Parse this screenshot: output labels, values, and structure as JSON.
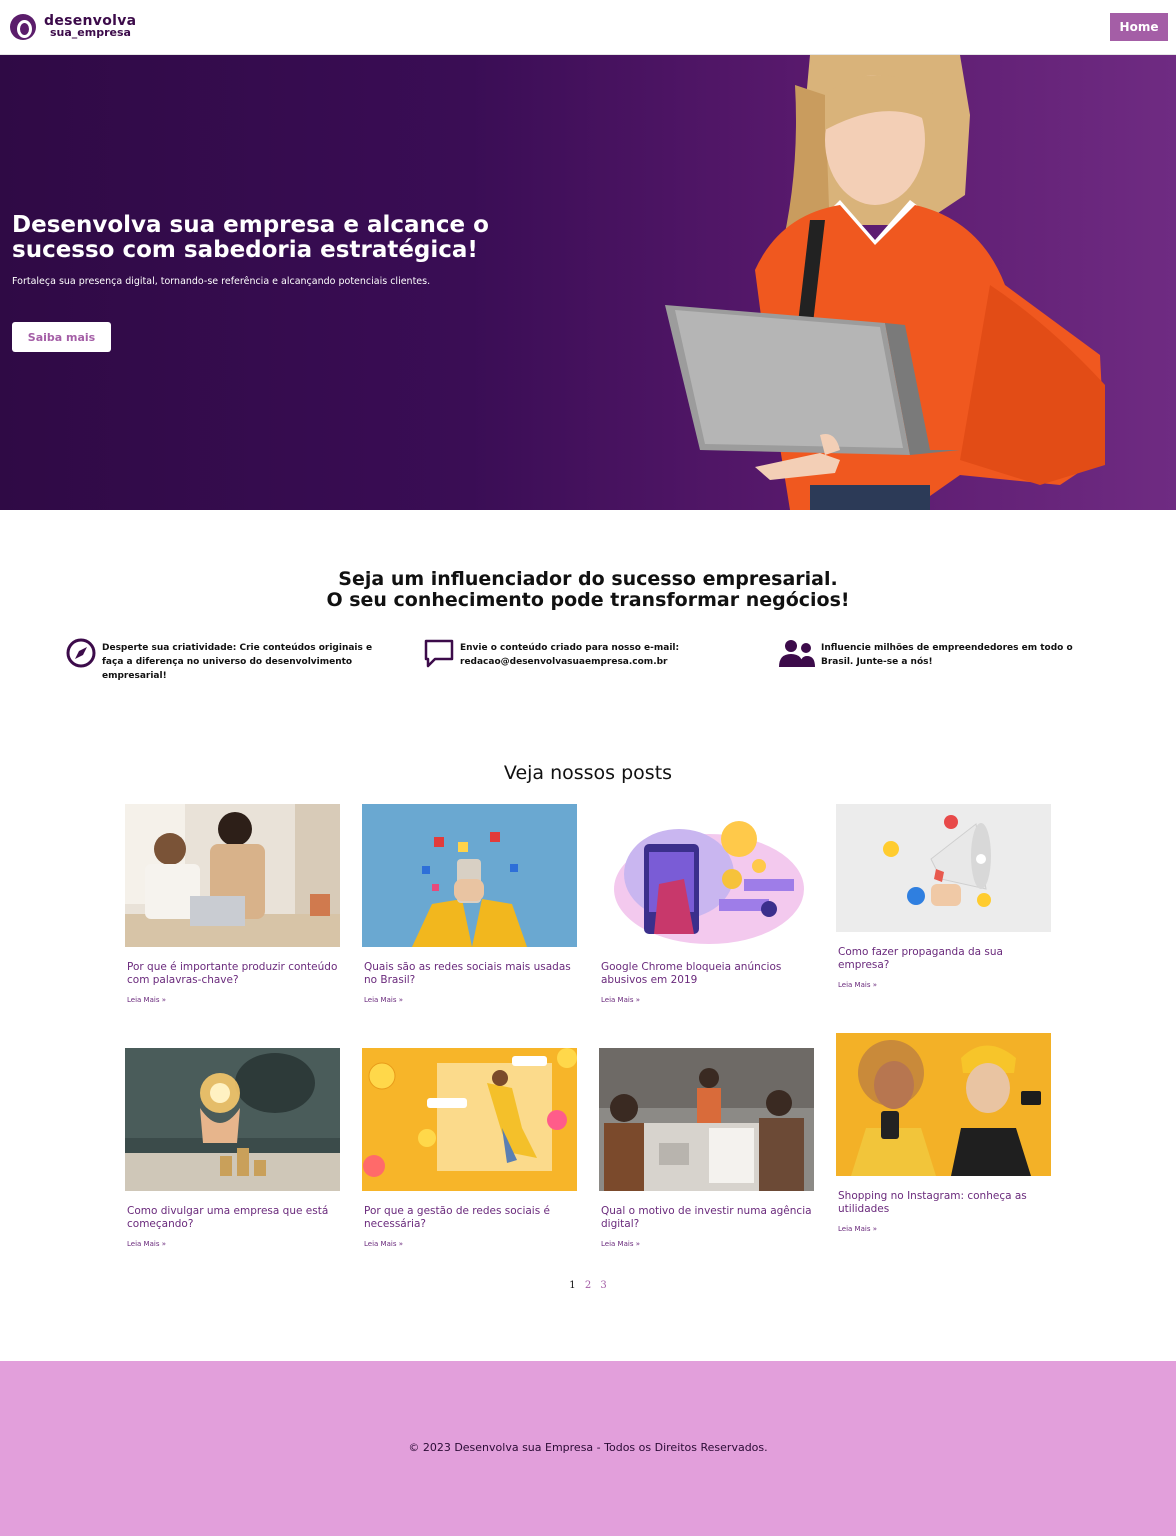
{
  "header": {
    "logo_top": "desenvolva",
    "logo_bottom": "sua_empresa",
    "nav_home": "Home"
  },
  "hero": {
    "title": "Desenvolva sua empresa e alcance o sucesso com sabedoria estratégica!",
    "subtitle": "Fortaleça sua presença digital, tornando-se referência e alcançando potenciais clientes.",
    "button": "Saiba mais"
  },
  "influencer": {
    "title_line1": "Seja um influenciador do sucesso empresarial.",
    "title_line2": "O seu conhecimento pode transformar negócios!",
    "features": [
      {
        "icon": "compass-icon",
        "text": "Desperte sua criatividade: Crie conteúdos originais e faça a diferença no universo do desenvolvimento empresarial!"
      },
      {
        "icon": "chat-bubble-icon",
        "text": "Envie o conteúdo criado para nosso e-mail: redacao@desenvolvasuaempresa.com.br"
      },
      {
        "icon": "users-icon",
        "text": "Influencie milhões de empreendedores em todo o Brasil. Junte-se a nós!"
      }
    ]
  },
  "posts": {
    "title": "Veja nossos posts",
    "read_more": "Leia Mais »",
    "items": [
      {
        "title": "Por que é importante produzir conteúdo com palavras-chave?"
      },
      {
        "title": "Quais são as redes sociais mais usadas no Brasil?"
      },
      {
        "title": "Google Chrome bloqueia anúncios abusivos em 2019"
      },
      {
        "title": "Como fazer propaganda da sua empresa?"
      },
      {
        "title": "Como divulgar uma empresa que está começando?"
      },
      {
        "title": "Por que a gestão de redes sociais é necessária?"
      },
      {
        "title": "Qual o motivo de investir numa agência digital?"
      },
      {
        "title": "Shopping no Instagram: conheça as utilidades"
      }
    ]
  },
  "pagination": {
    "current": "1",
    "p2": "2",
    "p3": "3"
  },
  "footer": {
    "text": "© 2023 Desenvolva sua Empresa - Todos os Direitos Reservados."
  },
  "colors": {
    "brand": "#a45ea6",
    "hero_dark": "#2f0a45",
    "footer": "#e29fdb"
  }
}
